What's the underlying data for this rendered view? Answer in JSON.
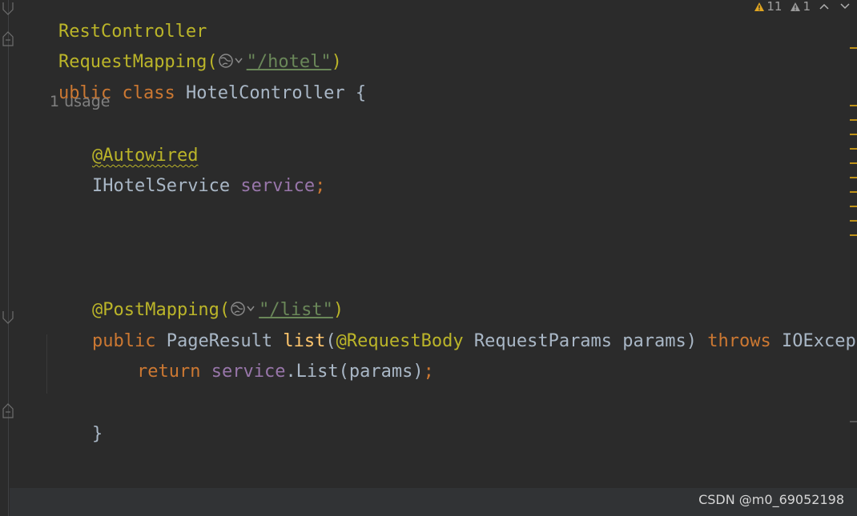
{
  "editor": {
    "lines": {
      "rest_controller": "RestController",
      "request_mapping": "RequestMapping(",
      "request_mapping_path": "\"/hotel\"",
      "request_mapping_close": ")",
      "class_public": "ublic",
      "class_kw": "class",
      "class_name": "HotelController",
      "class_brace": "{",
      "usage_hint": "1 usage",
      "autowired": "@Autowired",
      "service_type": "IHotelService",
      "service_name": "service",
      "service_semicolon": ";",
      "post_mapping": "@PostMapping(",
      "post_mapping_path": "\"/list\"",
      "post_mapping_close": ")",
      "method_public": "public",
      "method_return_type": "PageResult",
      "method_name": "list",
      "method_paren_open": "(",
      "method_param_annotation": "@RequestBody",
      "method_param_type": "RequestParams",
      "method_param_name": "params",
      "method_paren_close": ")",
      "method_throws": "throws",
      "method_exception": "IOExcep",
      "return_kw": "return",
      "return_target": "service",
      "return_call": ".List(params)",
      "return_semicolon": ";",
      "method_close_brace": "}"
    }
  },
  "inspections": {
    "warnings_count": "11",
    "weak_warnings_count": "1",
    "up_arrow": "up-chevron-icon",
    "down_arrow": "down-chevron-icon"
  },
  "watermark": "CSDN @m0_69052198",
  "colors": {
    "background": "#2b2b2b",
    "annotation": "#bbb529",
    "keyword": "#cc7832",
    "field": "#9876aa",
    "method": "#ffc66d",
    "string": "#6a8759",
    "warning_marker": "#be9117"
  }
}
